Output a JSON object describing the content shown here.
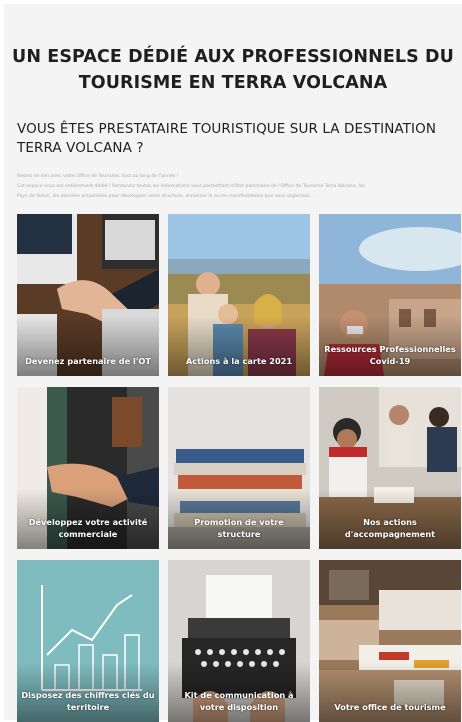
{
  "page": {
    "title": "UN ESPACE DÉDIÉ AUX PROFESSIONNELS DU TOURISME EN TERRA VOLCANA",
    "subtitle": "VOUS ÊTES PRESTATAIRE TOURISTIQUE SUR LA DESTINATION TERRA VOLCANA ?",
    "intro_lines": [
      "Restez en lien avec votre Office de Tourisme, tout au long de l'année !",
      "Cet espace vous est entièrement dédié ! Retrouvez toutes les informations vous permettant d'être partenaire de l'Office de Tourisme Terra Volcana, les",
      "Pays de Volvic, les données actualisées pour développer votre structure, annoncer la ou les manifestations que vous organisez..."
    ]
  },
  "tiles": [
    {
      "label": "Devenez partenaire de l'OT",
      "icon": "handshake-laptop-photo"
    },
    {
      "label": "Actions à la carte 2021",
      "icon": "women-landscape-photo"
    },
    {
      "label": "Ressources Professionnelles Covid-19",
      "icon": "mask-town-photo"
    },
    {
      "label": "Développez votre activité commerciale",
      "icon": "handshake-photo"
    },
    {
      "label": "Promotion de votre structure",
      "icon": "newspapers-photo"
    },
    {
      "label": "Nos actions d'accompagnement",
      "icon": "meeting-photo"
    },
    {
      "label": "Disposez des chiffres clés du territoire",
      "icon": "bar-chart-drawing"
    },
    {
      "label": "Kit de communication à votre disposition",
      "icon": "typewriter-photo"
    },
    {
      "label": "Votre office de tourisme",
      "icon": "office-desk-photo"
    }
  ]
}
